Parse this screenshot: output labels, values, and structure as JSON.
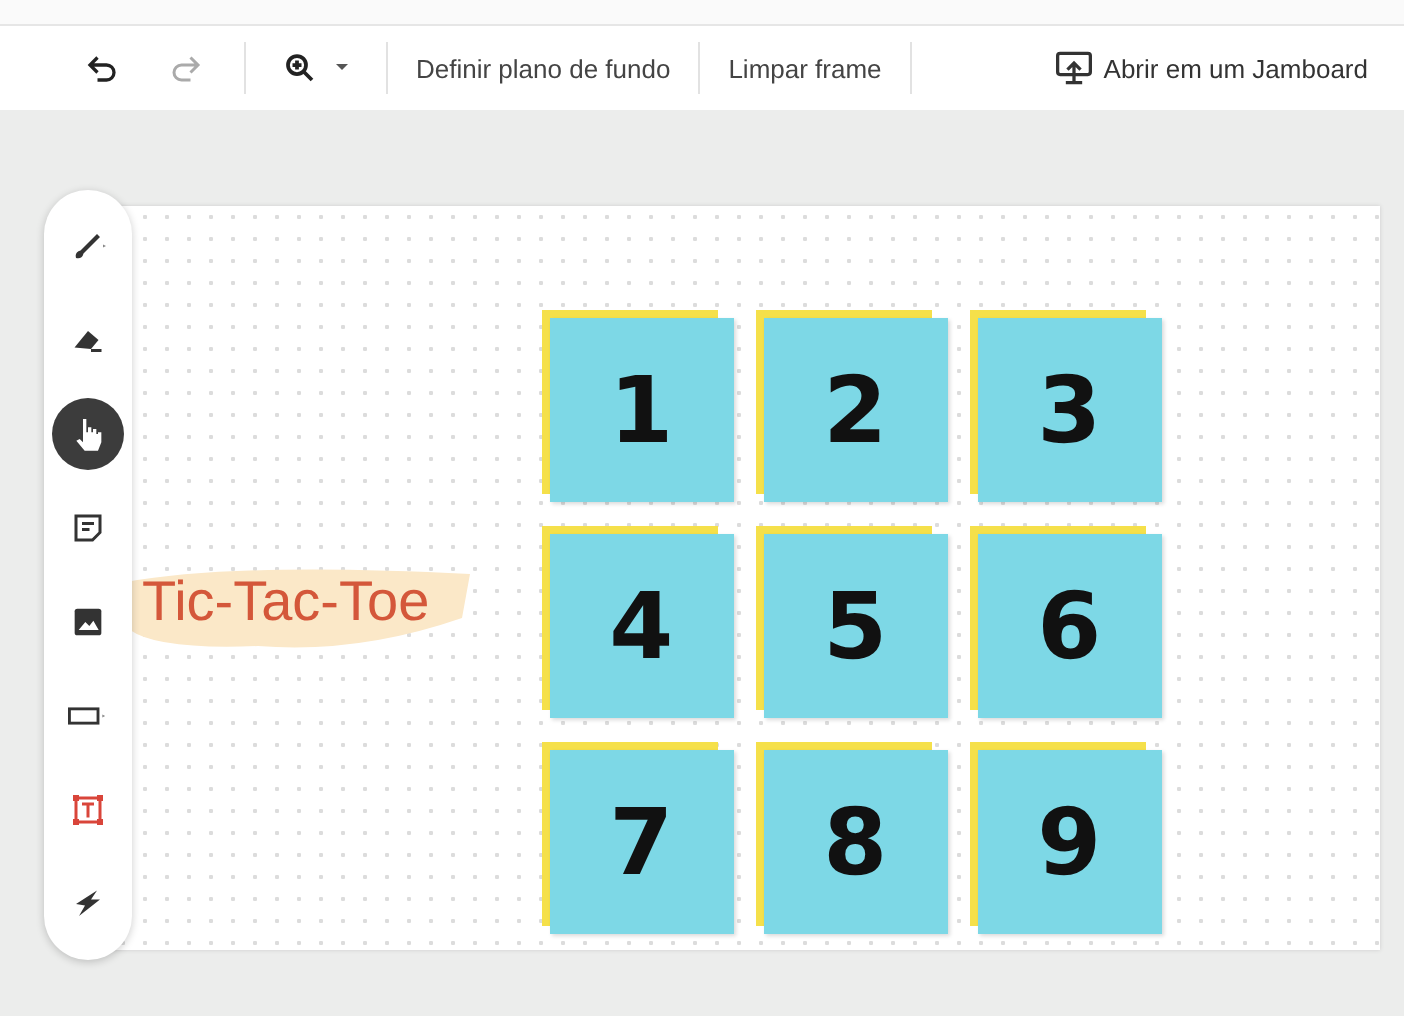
{
  "toolbar": {
    "undo": {
      "disabled": false
    },
    "redo": {
      "disabled": true
    },
    "actions": [
      {
        "label": "Definir plano de fundo"
      },
      {
        "label": "Limpar frame"
      }
    ],
    "open_button": {
      "label": "Abrir em um Jamboard"
    }
  },
  "tools": [
    {
      "kind": "pen",
      "selected": false
    },
    {
      "kind": "eraser",
      "selected": false
    },
    {
      "kind": "select",
      "selected": true
    },
    {
      "kind": "note",
      "selected": false
    },
    {
      "kind": "image",
      "selected": false
    },
    {
      "kind": "shape",
      "selected": false
    },
    {
      "kind": "textbox",
      "selected": false
    },
    {
      "kind": "laser",
      "selected": false
    }
  ],
  "canvas": {
    "title": "Tic-Tac-Toe",
    "tiles": [
      "1",
      "2",
      "3",
      "4",
      "5",
      "6",
      "7",
      "8",
      "9"
    ]
  }
}
